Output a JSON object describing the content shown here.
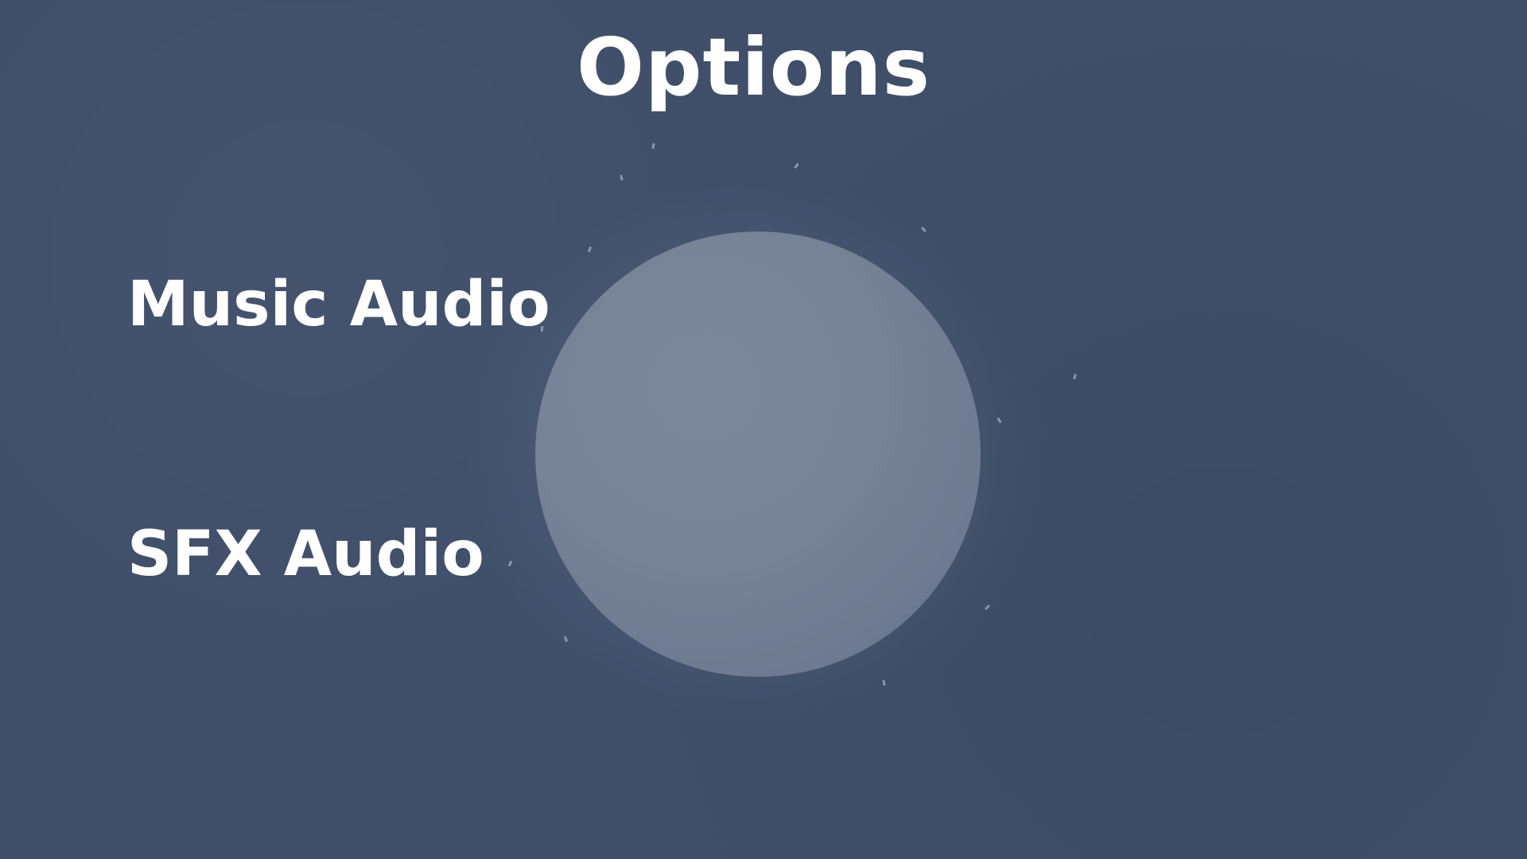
{
  "menu": {
    "title": "Options",
    "options": [
      {
        "label": "Music Audio"
      },
      {
        "label": "SFX Audio"
      }
    ]
  },
  "colors": {
    "background": "#3f4e69",
    "orb": "#778398",
    "text": "#ffffff"
  }
}
